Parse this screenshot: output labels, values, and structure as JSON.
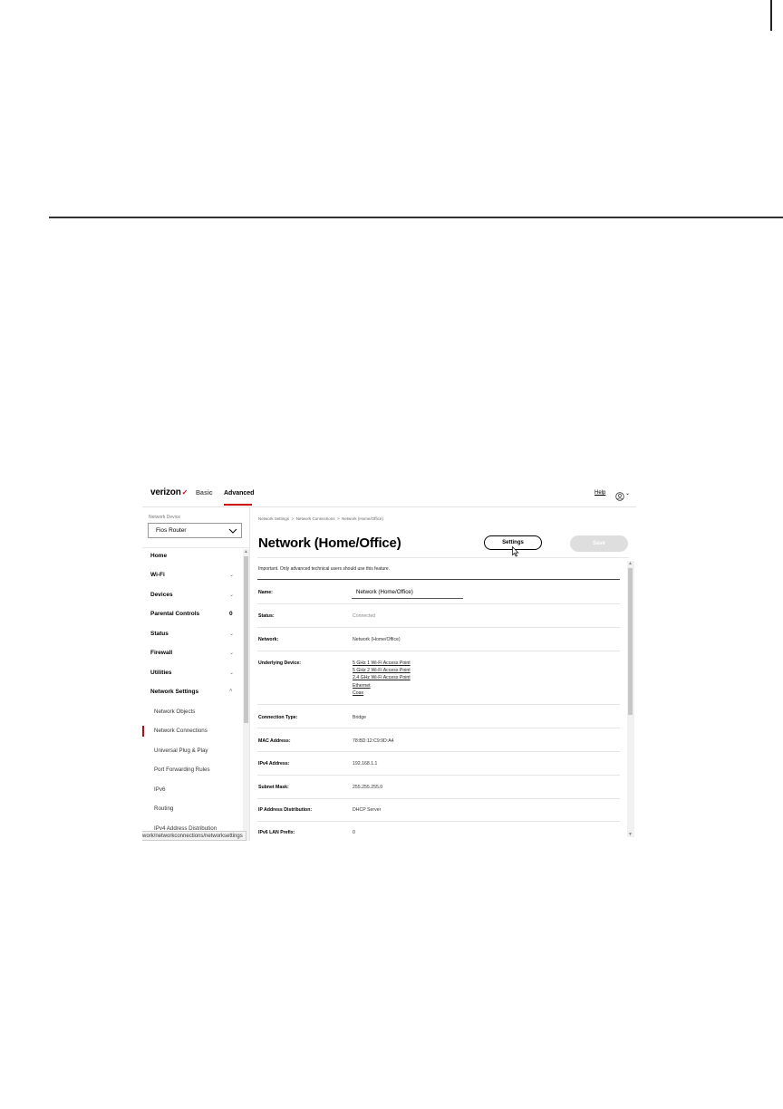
{
  "header": {
    "logo": "verizon",
    "logo_mark": "✓",
    "tabs": [
      "Basic",
      "Advanced"
    ],
    "help": "Help"
  },
  "sidebar": {
    "device_label": "Network Device",
    "device_value": "Fios Router",
    "items": [
      {
        "label": "Home"
      },
      {
        "label": "Wi-Fi"
      },
      {
        "label": "Devices"
      },
      {
        "label": "Parental Controls",
        "badge": "0"
      },
      {
        "label": "Status"
      },
      {
        "label": "Firewall"
      },
      {
        "label": "Utilities"
      },
      {
        "label": "Network Settings"
      }
    ],
    "subitems": [
      "Network Objects",
      "Network Connections",
      "Universal Plug & Play",
      "Port Forwarding Rules",
      "IPv6",
      "Routing",
      "IPv4 Address Distribution"
    ],
    "status_url": "work/networkconnections/networksettings"
  },
  "main": {
    "breadcrumb": [
      "Network Settings",
      "Network Connections",
      "Network (Home/Office)"
    ],
    "title": "Network (Home/Office)",
    "settings_button": "Settings",
    "save_button": "Save",
    "note": "Important. Only advanced technical users should use this feature.",
    "rows": {
      "name": {
        "label": "Name:",
        "value": "Network (Home/Office)"
      },
      "status": {
        "label": "Status:",
        "value": "Connected"
      },
      "network": {
        "label": "Network:",
        "value": "Network (Home/Office)"
      },
      "underlying": {
        "label": "Underlying Device:",
        "devices": [
          "5 GHz 1 Wi-Fi Access Point",
          "5 GHz 2 Wi-Fi Access Point",
          "2.4 GHz Wi-Fi Access Point",
          "Ethernet",
          "Coax"
        ]
      },
      "connection_type": {
        "label": "Connection Type:",
        "value": "Bridge"
      },
      "mac": {
        "label": "MAC Address:",
        "value": "78:BD:12:C9:9D:A4"
      },
      "ipv4": {
        "label": "IPv4 Address:",
        "value": "192.168.1.1"
      },
      "subnet": {
        "label": "Subnet Mask:",
        "value": "255.255.255.0"
      },
      "ip_dist": {
        "label": "IP Address Distribution:",
        "value": "DHCP Server"
      },
      "ipv6_prefix": {
        "label": "IPv6 LAN Prefix:",
        "value": "0"
      }
    }
  },
  "colors": {
    "accent": "#cd040b",
    "save_disabled": "#dedede"
  }
}
